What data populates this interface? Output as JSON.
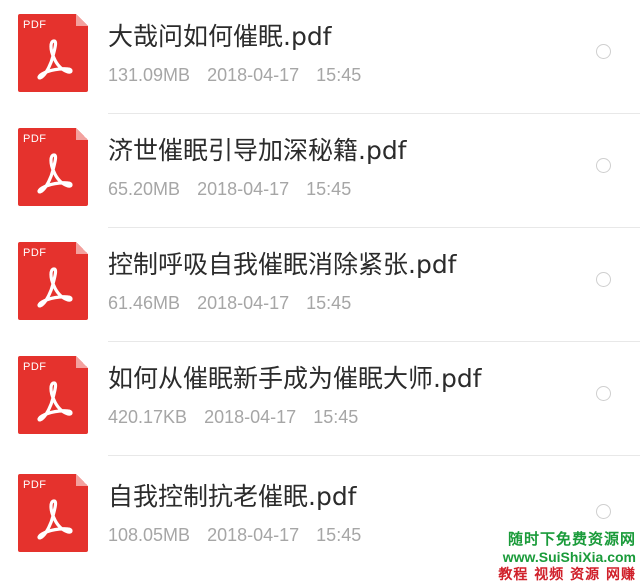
{
  "files": [
    {
      "icon_label": "PDF",
      "name": "大哉问如何催眠.pdf",
      "size": "131.09MB",
      "date": "2018-04-17",
      "time": "15:45"
    },
    {
      "icon_label": "PDF",
      "name": "济世催眠引导加深秘籍.pdf",
      "size": "65.20MB",
      "date": "2018-04-17",
      "time": "15:45"
    },
    {
      "icon_label": "PDF",
      "name": "控制呼吸自我催眠消除紧张.pdf",
      "size": "61.46MB",
      "date": "2018-04-17",
      "time": "15:45"
    },
    {
      "icon_label": "PDF",
      "name": "如何从催眠新手成为催眠大师.pdf",
      "size": "420.17KB",
      "date": "2018-04-17",
      "time": "15:45"
    },
    {
      "icon_label": "PDF",
      "name": "自我控制抗老催眠.pdf",
      "size": "108.05MB",
      "date": "2018-04-17",
      "time": "15:45"
    }
  ],
  "watermark": {
    "line1": "随时下免费资源网",
    "line2": "www.SuiShiXia.com",
    "line3": "教程 视频 资源 网赚"
  },
  "colors": {
    "pdf_red": "#e5322d",
    "name_text": "#2b2b2b",
    "meta_text": "#a6a6a6",
    "divider": "#e8e8e8"
  }
}
